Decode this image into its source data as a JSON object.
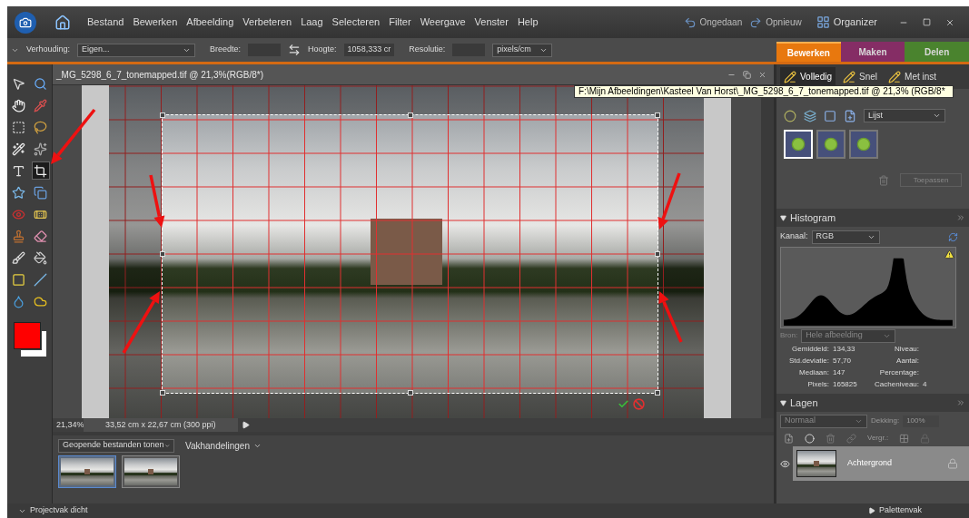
{
  "menu": {
    "items": [
      "Bestand",
      "Bewerken",
      "Afbeelding",
      "Verbeteren",
      "Laag",
      "Selecteren",
      "Filter",
      "Weergave",
      "Venster",
      "Help"
    ]
  },
  "history": [
    {
      "kind": "undo",
      "label": "Ongedaan"
    },
    {
      "kind": "redo",
      "label": "Opnieuw"
    }
  ],
  "organizer": {
    "label": "Organizer"
  },
  "options": {
    "ratio_label": "Verhouding:",
    "ratio_value": "Eigen...",
    "width_label": "Breedte:",
    "height_label": "Hoogte:",
    "height_value": "1058,333 cr",
    "resolution_label": "Resolutie:",
    "unit_value": "pixels/cm"
  },
  "modes": [
    {
      "label": "Bewerken",
      "selected": true,
      "color": "#e8780e"
    },
    {
      "label": "Maken",
      "selected": false,
      "color": "#8c2a68"
    },
    {
      "label": "Delen",
      "selected": false,
      "color": "#4b8a2b"
    }
  ],
  "edit_modes": [
    {
      "label": "Volledig",
      "selected": true
    },
    {
      "label": "Snel",
      "selected": false
    },
    {
      "label": "Met inst",
      "selected": false
    }
  ],
  "tools": [
    {
      "selected": false
    },
    {
      "selected": false
    },
    {
      "selected": false
    },
    {
      "selected": false
    },
    {
      "selected": false
    },
    {
      "selected": false
    },
    {
      "selected": false
    },
    {
      "selected": false
    },
    {
      "selected": false
    },
    {
      "selected": true
    },
    {
      "selected": false
    },
    {
      "selected": false
    },
    {
      "selected": false
    },
    {
      "selected": false
    },
    {
      "selected": false
    },
    {
      "selected": false
    },
    {
      "selected": false
    },
    {
      "selected": false
    },
    {
      "selected": false
    },
    {
      "selected": false
    },
    {
      "selected": false
    },
    {
      "selected": false
    }
  ],
  "document": {
    "title": "_MG_5298_6_7_tonemapped.tif @ 21,3%(RGB/8*)",
    "tooltip": "F:\\Mijn Afbeeldingen\\Kasteel Van Horst\\_MG_5298_6_7_tonemapped.tif @ 21,3% (RGB/8*",
    "zoom": "21,34%",
    "size": "33,52 cm x 22,67 cm (300 ppi)"
  },
  "project_bin": {
    "show": "Geopende bestanden tonen",
    "actions": "Vakhandelingen",
    "files": [
      {
        "selected": true
      },
      {
        "selected": false
      }
    ]
  },
  "effects": {
    "view": "Lijst",
    "items": [
      {
        "selected": true
      },
      {
        "selected": false
      },
      {
        "selected": false
      }
    ],
    "apply": "Toepassen",
    "apply_disabled": true
  },
  "histogram": {
    "title": "Histogram",
    "channel_label": "Kanaal:",
    "channel": "RGB",
    "source_label": "Bron:",
    "source": "Hele afbeelding",
    "source_disabled": true,
    "stats_left": [
      {
        "label": "Gemiddeld:",
        "value": "134,33"
      },
      {
        "label": "Std.deviatie:",
        "value": "57,70"
      },
      {
        "label": "Mediaan:",
        "value": "147"
      },
      {
        "label": "Pixels:",
        "value": "165825"
      }
    ],
    "stats_right": [
      {
        "label": "Niveau:"
      },
      {
        "label": "Aantal:"
      },
      {
        "label": "Percentage:"
      },
      {
        "label": "Cacheniveau:",
        "value": "4"
      }
    ]
  },
  "layers": {
    "title": "Lagen",
    "blend": "Normaal",
    "blend_disabled": true,
    "opacity_label": "Dekking:",
    "opacity": "100%",
    "lock_label": "Vergr.:",
    "items": [
      {
        "name": "Achtergrond",
        "selected": true,
        "visible": true,
        "locked": true
      }
    ]
  },
  "status_bar": {
    "left": "Projectvak dicht",
    "right": "Palettenvak"
  }
}
